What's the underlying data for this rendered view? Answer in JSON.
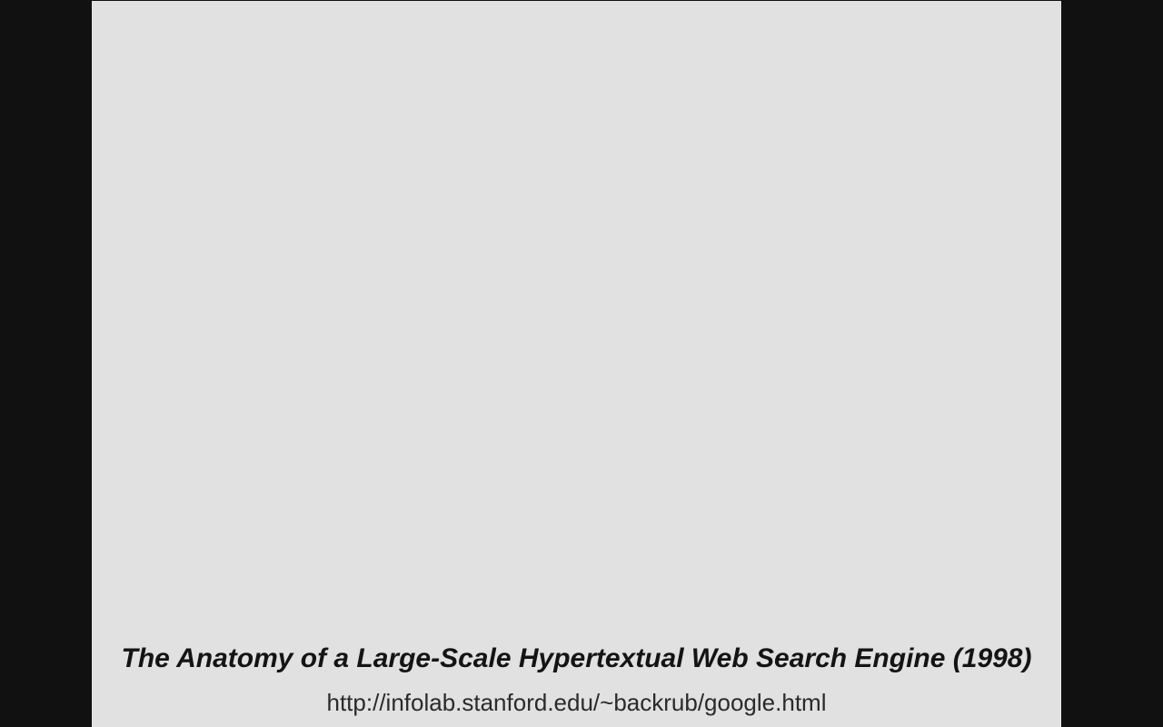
{
  "slide": {
    "title": "The Anatomy of a Large-Scale Hypertextual Web Search Engine (1998)",
    "url": "http://infolab.stanford.edu/~backrub/google.html"
  },
  "colors": {
    "background": "#111111",
    "slide": "#e0e1e0",
    "text": "#141414"
  }
}
